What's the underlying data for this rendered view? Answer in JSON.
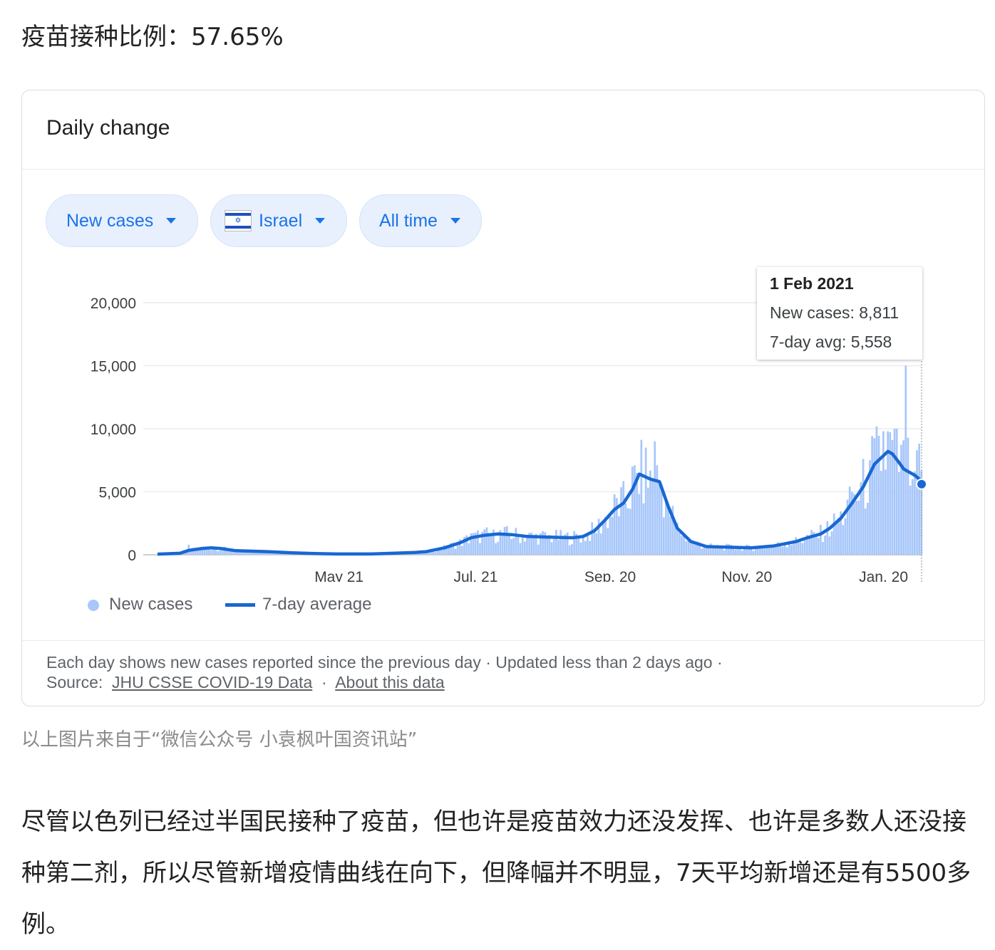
{
  "headline": "疫苗接种比例：57.65%",
  "card": {
    "title": "Daily change",
    "chips": {
      "metric": "New cases",
      "country": "Israel",
      "range": "All time"
    },
    "tooltip": {
      "date": "1 Feb 2021",
      "new_cases": "New cases: 8,811",
      "avg": "7-day avg: 5,558"
    },
    "legend": {
      "new_cases": "New cases",
      "avg": "7-day average"
    },
    "footer": {
      "line1": "Each day shows new cases reported since the previous day · Updated less than 2 days ago ·",
      "source_label": "Source:",
      "source_link": "JHU CSSE COVID-19 Data",
      "sep": "·",
      "about_link": "About this data"
    }
  },
  "colors": {
    "bars": "#a8c7fa",
    "line": "#1967d2",
    "chip_bg": "#e8f0fe",
    "chip_text": "#1a73e8"
  },
  "chart_data": {
    "type": "bar",
    "title": "",
    "yticks": [
      "20,000",
      "15,000",
      "10,000",
      "5,000",
      "0"
    ],
    "ylim": [
      0,
      20000
    ],
    "xticks": [
      "May 21",
      "Jul. 21",
      "Sep. 20",
      "Nov. 20",
      "Jan. 20"
    ],
    "xtick_days": [
      81,
      142,
      202,
      263,
      324
    ],
    "x_start": "2020-03-01",
    "x_end": "2021-02-01",
    "series": [
      {
        "name": "7-day average",
        "type": "line",
        "points": [
          [
            0,
            50
          ],
          [
            10,
            120
          ],
          [
            14,
            350
          ],
          [
            20,
            500
          ],
          [
            24,
            550
          ],
          [
            28,
            500
          ],
          [
            35,
            320
          ],
          [
            50,
            240
          ],
          [
            60,
            160
          ],
          [
            70,
            100
          ],
          [
            80,
            60
          ],
          [
            95,
            60
          ],
          [
            105,
            120
          ],
          [
            115,
            180
          ],
          [
            120,
            250
          ],
          [
            128,
            550
          ],
          [
            135,
            950
          ],
          [
            140,
            1350
          ],
          [
            146,
            1550
          ],
          [
            152,
            1650
          ],
          [
            158,
            1600
          ],
          [
            165,
            1450
          ],
          [
            175,
            1400
          ],
          [
            185,
            1350
          ],
          [
            190,
            1450
          ],
          [
            195,
            1900
          ],
          [
            200,
            2800
          ],
          [
            204,
            3600
          ],
          [
            208,
            4100
          ],
          [
            212,
            5200
          ],
          [
            215,
            6400
          ],
          [
            220,
            6000
          ],
          [
            224,
            5800
          ],
          [
            228,
            3800
          ],
          [
            232,
            2100
          ],
          [
            238,
            1050
          ],
          [
            245,
            650
          ],
          [
            255,
            600
          ],
          [
            265,
            550
          ],
          [
            275,
            700
          ],
          [
            285,
            1050
          ],
          [
            290,
            1350
          ],
          [
            296,
            1650
          ],
          [
            300,
            2100
          ],
          [
            305,
            2900
          ],
          [
            310,
            4100
          ],
          [
            315,
            5400
          ],
          [
            320,
            7200
          ],
          [
            326,
            8200
          ],
          [
            328,
            8000
          ],
          [
            331,
            7300
          ],
          [
            333,
            6800
          ],
          [
            336,
            6500
          ],
          [
            338,
            6300
          ],
          [
            340,
            6000
          ],
          [
            341,
            5600
          ]
        ]
      },
      {
        "name": "New cases",
        "type": "bar",
        "sample_peaks": [
          [
            14,
            800
          ],
          [
            100,
            150
          ],
          [
            140,
            1700
          ],
          [
            150,
            2000
          ],
          [
            205,
            4500
          ],
          [
            212,
            7000
          ],
          [
            218,
            8500
          ],
          [
            222,
            9000
          ],
          [
            228,
            4000
          ],
          [
            240,
            800
          ],
          [
            310,
            5000
          ],
          [
            318,
            7500
          ],
          [
            324,
            9800
          ],
          [
            330,
            10000
          ],
          [
            334,
            15000
          ],
          [
            337,
            6000
          ],
          [
            340,
            8811
          ]
        ]
      }
    ]
  }
}
